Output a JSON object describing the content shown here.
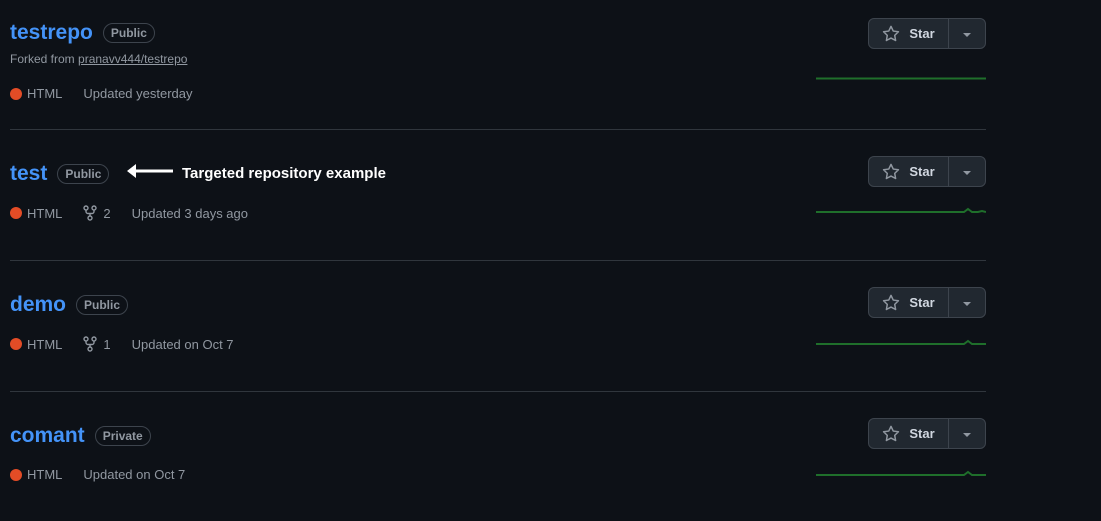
{
  "repos": [
    {
      "name": "testrepo",
      "visibility": "Public",
      "forked_label": "Forked from",
      "forked_from": "pranavv444/testrepo",
      "language": "HTML",
      "forks": null,
      "updated": "Updated yesterday",
      "star_label": "Star"
    },
    {
      "name": "test",
      "visibility": "Public",
      "forked_label": null,
      "forked_from": null,
      "language": "HTML",
      "forks": "2",
      "updated": "Updated 3 days ago",
      "star_label": "Star"
    },
    {
      "name": "demo",
      "visibility": "Public",
      "forked_label": null,
      "forked_from": null,
      "language": "HTML",
      "forks": "1",
      "updated": "Updated on Oct 7",
      "star_label": "Star"
    },
    {
      "name": "comant",
      "visibility": "Private",
      "forked_label": null,
      "forked_from": null,
      "language": "HTML",
      "forks": null,
      "updated": "Updated on Oct 7",
      "star_label": "Star"
    }
  ],
  "annotation": {
    "text": "Targeted repository example"
  },
  "colors": {
    "background": "#0d1117",
    "link": "#4493f8",
    "html_language": "#e34c26",
    "sparkline": "#1f6f2b"
  }
}
